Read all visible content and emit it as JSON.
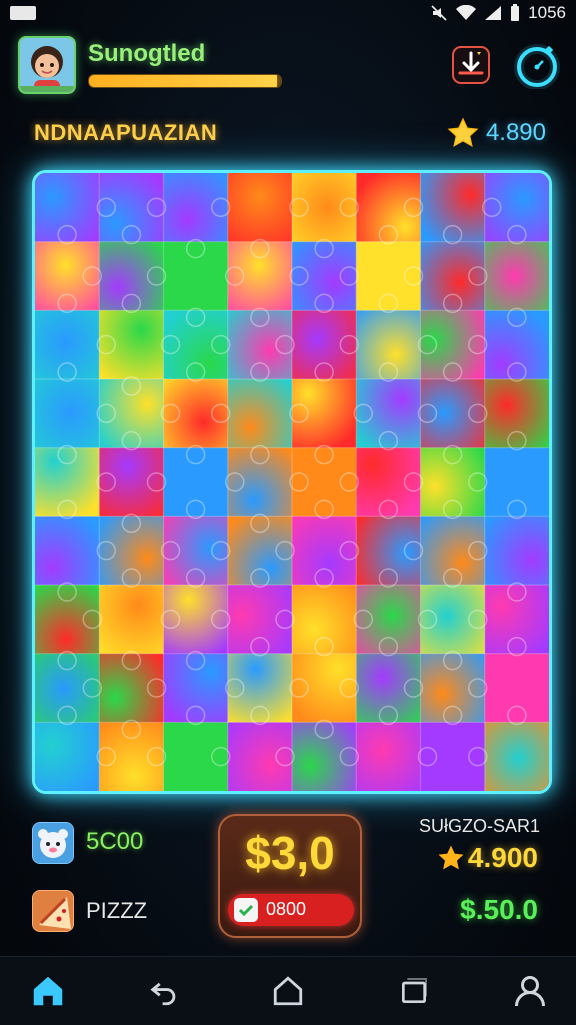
{
  "status_bar": {
    "time": "1056"
  },
  "header": {
    "title": "Sunogtled",
    "progress_fraction": 0.98
  },
  "level": {
    "name": "NDNAAPUAZIAN",
    "score": "4.890"
  },
  "board": {
    "rows": 9,
    "cols": 8,
    "palette": [
      "#ff2a2a",
      "#ffe02a",
      "#2ad84a",
      "#2a9aff",
      "#a43aff",
      "#ff8a1a",
      "#22d0d0",
      "#ff3ab0"
    ]
  },
  "bottom": {
    "bear_value": "5C00",
    "pizza_label": "PIZZZ",
    "center_price": "$3,0",
    "center_pill_value": "0800",
    "right_label": "SUłGZO-SAR1",
    "right_stars": "4.900",
    "right_cash": "$.50.0"
  },
  "colors": {
    "accent_cyan": "#5ff0ff",
    "gold": "#ffd93a",
    "green": "#5af05a"
  },
  "nav": {
    "items": [
      "home-icon",
      "back-icon",
      "house-outline-icon",
      "square-icon",
      "profile-icon"
    ]
  }
}
